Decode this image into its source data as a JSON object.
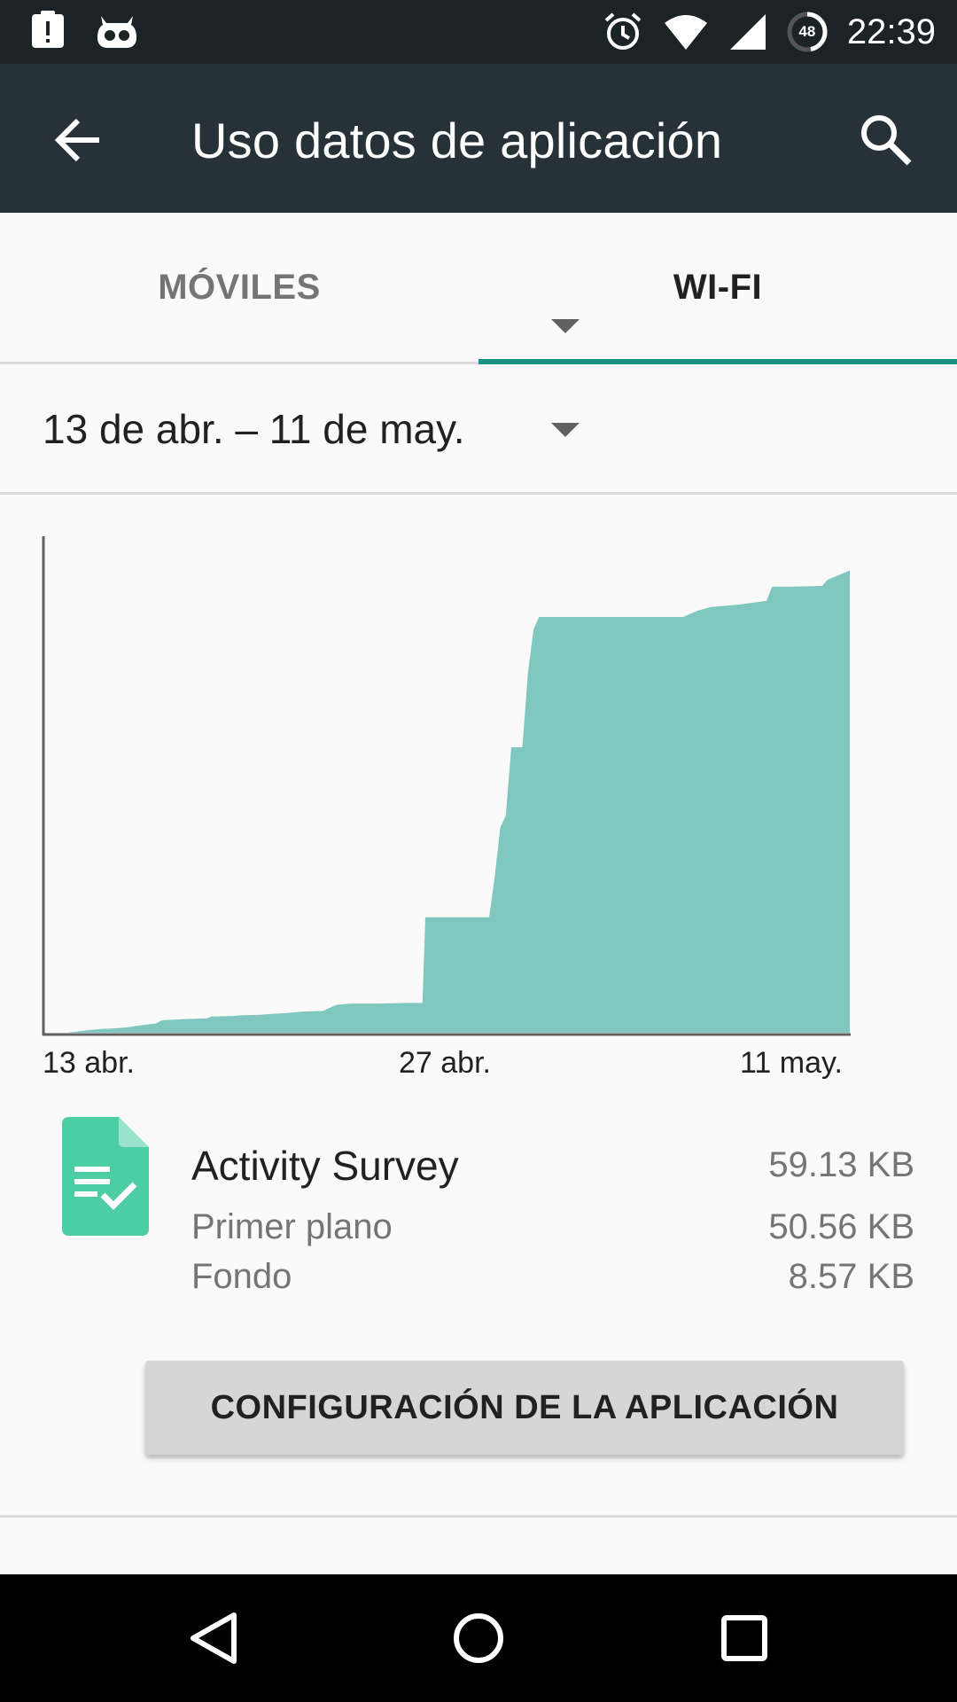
{
  "status_bar": {
    "time": "22:39",
    "battery_level": "48",
    "icons": [
      "notification-alert-icon",
      "cyanogen-mod-icon",
      "alarm-icon",
      "wifi-icon",
      "cell-signal-icon",
      "battery-icon"
    ]
  },
  "app_bar": {
    "title": "Uso datos de aplicación",
    "back_icon": "arrow-back-icon",
    "search_icon": "search-icon",
    "colors": {
      "background": "#263238",
      "status": "#1b2327"
    }
  },
  "tabs": [
    {
      "label": "MÓVILES",
      "selected": false
    },
    {
      "label": "WI-FI",
      "selected": true
    }
  ],
  "period": {
    "label": "13 de abr. – 11 de may."
  },
  "chart_data": {
    "type": "area",
    "x_tick_labels": [
      "13 abr.",
      "27 abr.",
      "11 may."
    ],
    "x_days": [
      0,
      0.8,
      1,
      1.5,
      2,
      2.5,
      3,
      3.3,
      4,
      4.2,
      5,
      5.8,
      6,
      6.8,
      7,
      7.8,
      8,
      8.8,
      9,
      9.2,
      10,
      10.5,
      11,
      12,
      13,
      13.6,
      13.7,
      14,
      15,
      16,
      16.2,
      16.4,
      16.6,
      16.8,
      17,
      17.2,
      17.4,
      17.6,
      17.8,
      18,
      19,
      20,
      21,
      22,
      23,
      23.5,
      24,
      25,
      26,
      26.2,
      27,
      28,
      28.2,
      29
    ],
    "values": [
      0,
      0,
      0.1,
      0.4,
      0.6,
      0.7,
      0.9,
      1.1,
      1.5,
      2.0,
      2.2,
      2.3,
      2.6,
      2.7,
      2.8,
      2.9,
      3.0,
      3.2,
      3.3,
      3.4,
      3.5,
      4.5,
      4.7,
      4.7,
      4.8,
      4.8,
      18.6,
      18.6,
      18.6,
      18.6,
      25.0,
      33.0,
      35.0,
      46.0,
      46.0,
      46.0,
      58.0,
      65.0,
      67.0,
      67.0,
      67.0,
      67.0,
      67.0,
      67.0,
      67.0,
      68.0,
      68.6,
      69.0,
      69.6,
      71.9,
      71.9,
      72.0,
      73.0,
      74.5
    ],
    "y_unit": "relative",
    "ylim": [
      0,
      80
    ],
    "colors": {
      "fill": "#80c8bf",
      "axis": "#616161"
    }
  },
  "app": {
    "name": "Activity Survey",
    "total": "59.13 KB",
    "rows": [
      {
        "label": "Primer plano",
        "value": "50.56 KB"
      },
      {
        "label": "Fondo",
        "value": "8.57 KB"
      }
    ],
    "icon": "document-check-icon",
    "icon_color": "#4ccda4"
  },
  "config_button": {
    "label": "CONFIGURACIÓN DE LA APLICACIÓN"
  },
  "nav_bar": {
    "icons": [
      "back-nav-icon",
      "home-nav-icon",
      "recents-nav-icon"
    ]
  }
}
